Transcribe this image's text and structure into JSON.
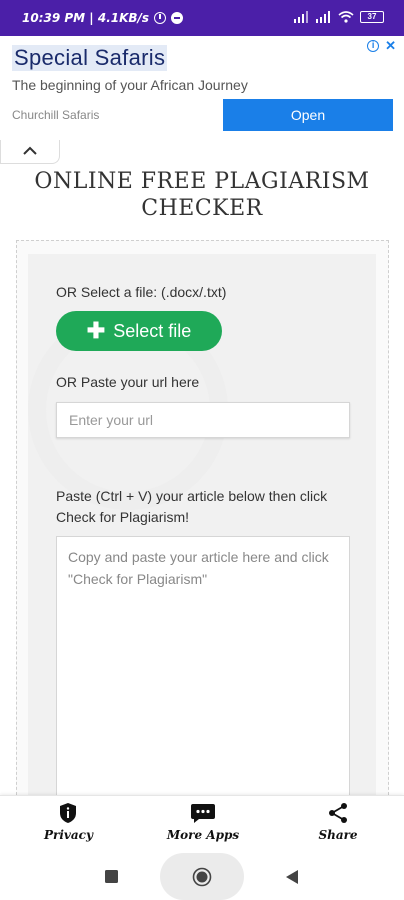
{
  "status_bar": {
    "time_speed": "10:39 PM | 4.1KB/s",
    "battery": "37"
  },
  "ad": {
    "title": "Special Safaris",
    "subtitle": "The beginning of your African Journey",
    "advertiser": "Churchill Safaris",
    "open_label": "Open",
    "info_icon": "i",
    "close_icon": "✕"
  },
  "page": {
    "title_line1": "ONLINE FREE PLAGIARISM",
    "title_line2": "CHECKER"
  },
  "form": {
    "file_label": "OR Select a file: (.docx/.txt)",
    "select_file_label": "Select file",
    "url_label": "OR Paste your url here",
    "url_placeholder": "Enter your url",
    "paste_label_line1": "Paste (Ctrl + V) your article below then click",
    "paste_label_line2": "Check for Plagiarism!",
    "article_placeholder": "Copy and paste your article here and click \"Check for Plagiarism\""
  },
  "bottom_nav": {
    "privacy": "Privacy",
    "more_apps": "More Apps",
    "share": "Share"
  },
  "colors": {
    "status_bar": "#4b1fa8",
    "ad_button": "#1a7fe8",
    "select_button": "#1fa958"
  }
}
